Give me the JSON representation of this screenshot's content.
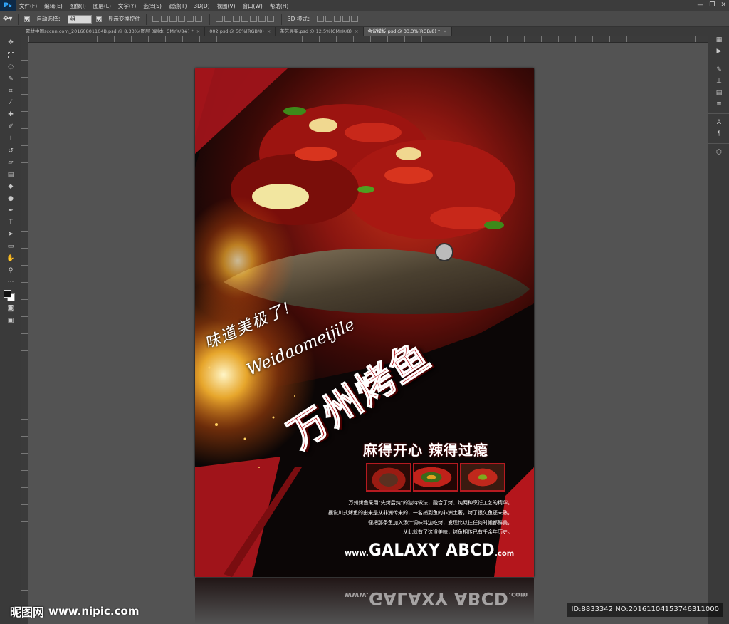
{
  "app": {
    "logo": "Ps",
    "menu": [
      "文件(F)",
      "编辑(E)",
      "图像(I)",
      "图层(L)",
      "文字(Y)",
      "选择(S)",
      "滤镜(T)",
      "3D(D)",
      "视图(V)",
      "窗口(W)",
      "帮助(H)"
    ],
    "window_controls": [
      "—",
      "❐",
      "✕"
    ]
  },
  "options_bar": {
    "auto_select_label": "自动选择：",
    "auto_select_value": "组",
    "show_transform_label": "显示变换控件",
    "mode_label": "3D 模式："
  },
  "tabs": [
    {
      "label": "素材中国sccnn.com_20160801104B.psd @ 8.33%(图层 0副本, CMYK/8#) *",
      "active": false
    },
    {
      "label": "002.psd @ 50%(RGB/8)",
      "active": false
    },
    {
      "label": "茶艺展架.psd @ 12.5%(CMYK/8)",
      "active": false
    },
    {
      "label": "会议模板.psd @ 33.3%(RGB/8) *",
      "active": true
    }
  ],
  "poster": {
    "slogan_script": "味道美极了!",
    "slogan_pinyin": "Weidaomeijile",
    "title": "万州烤鱼",
    "tagline": "麻得开心  辣得过瘾",
    "description": [
      "万州烤鱼采用\"先烤后炖\"的独特做法，融合了烤、炖两种烹饪工艺的精华。",
      "据说川式烤鱼的由来是从非洲传来的，一名捕到鱼的非洲土著，烤了很久鱼还未熟，",
      "便把那条鱼加入汤汁调味料边吃烤，发现比以往任何时候都鲜美，",
      "从此就有了这道美味，烤鱼相传已有千余年历史。"
    ],
    "website_prefix": "www.",
    "website_main": "GALAXY ABCD",
    "website_suffix": ".com"
  },
  "watermark": {
    "left_logo": "昵图网",
    "left_url": "www.nipic.com",
    "right_id": "ID:8833342 NO:20161104153746311000"
  },
  "colors": {
    "accent_red": "#b4161c",
    "dark_red": "#7a0d10",
    "ui_bg": "#535353",
    "panel_bg": "#3a3a3a"
  }
}
